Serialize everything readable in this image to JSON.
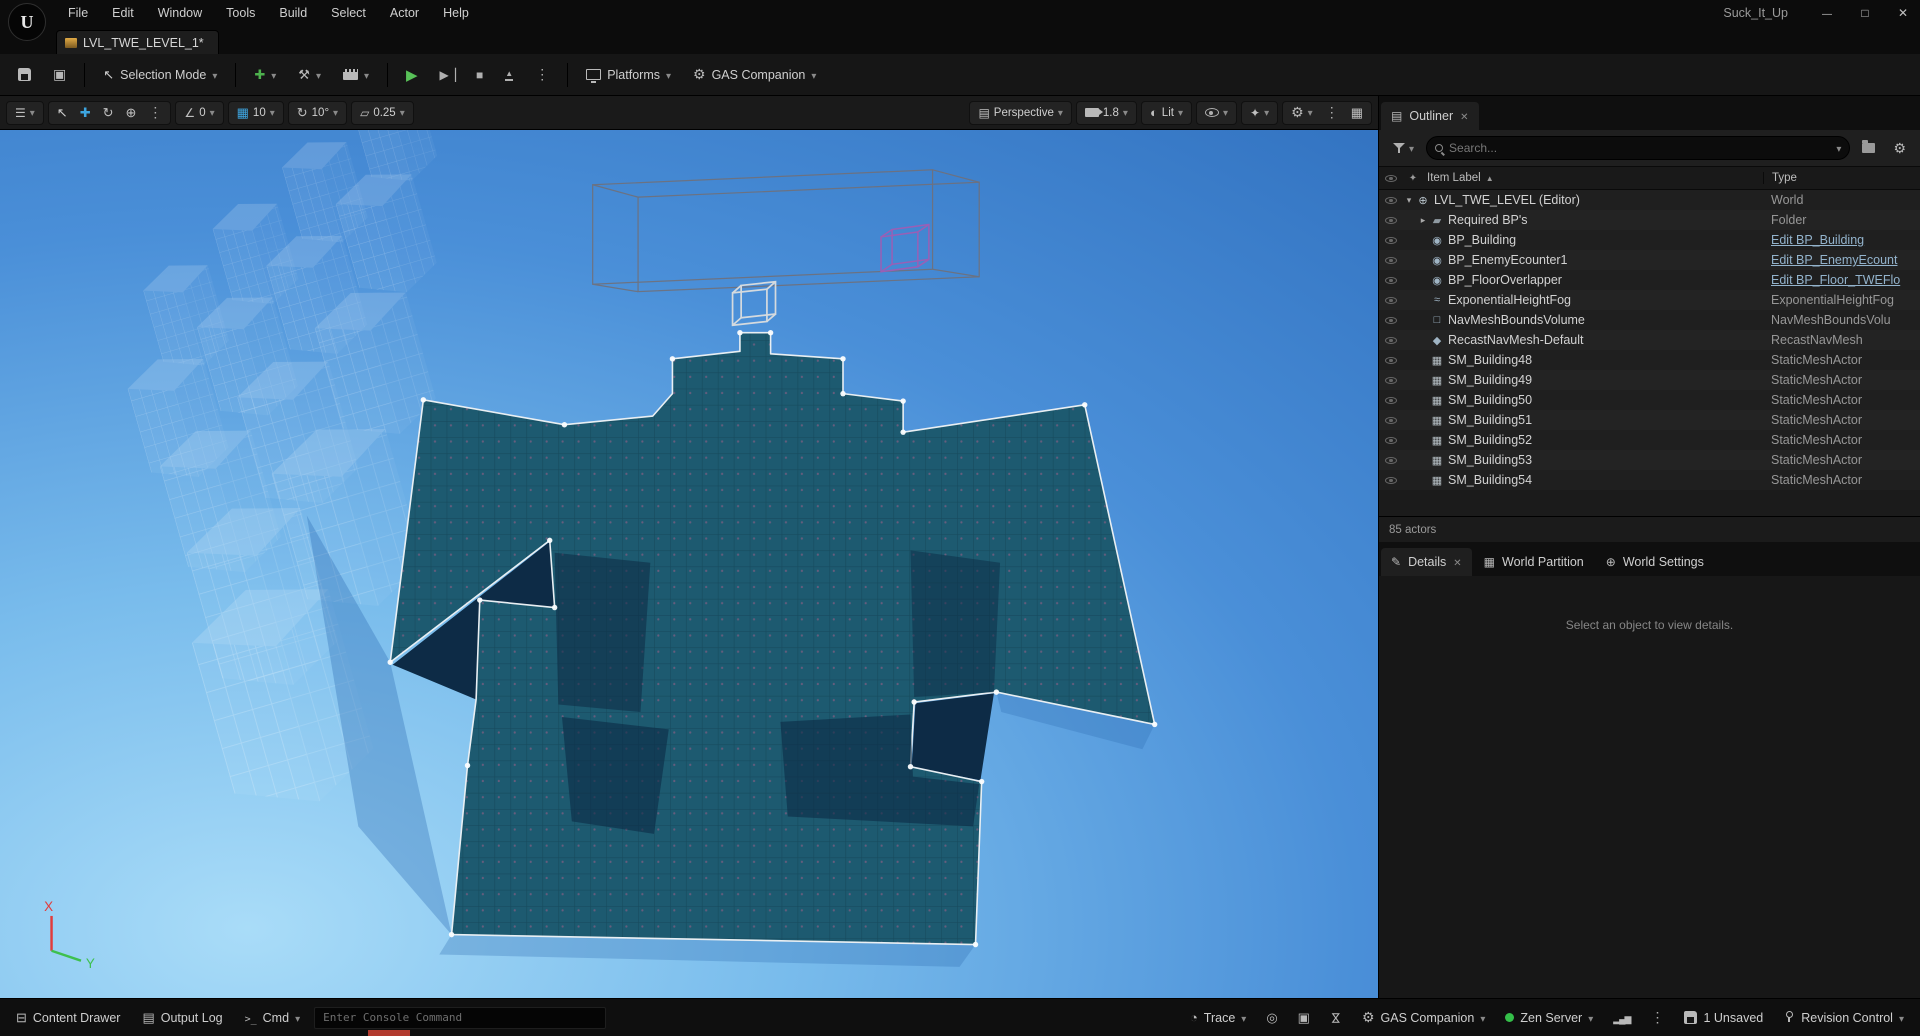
{
  "titlebar": {
    "menu": [
      "File",
      "Edit",
      "Window",
      "Tools",
      "Build",
      "Select",
      "Actor",
      "Help"
    ],
    "project": "Suck_It_Up"
  },
  "tab": {
    "label": "LVL_TWE_LEVEL_1*"
  },
  "toolbar": {
    "selection_mode": "Selection Mode",
    "platforms": "Platforms",
    "gas_companion": "GAS Companion"
  },
  "viewport": {
    "perspective": "Perspective",
    "camera_speed": "1.8",
    "view_mode": "Lit",
    "snap_actor": "0",
    "snap_grid": "10",
    "snap_rotation": "10°",
    "snap_scale": "0.25",
    "axis_x": "X",
    "axis_y": "Y"
  },
  "outliner": {
    "title": "Outliner",
    "search_placeholder": "Search...",
    "col_item": "Item Label",
    "col_type": "Type",
    "footer": "85 actors",
    "rows": [
      {
        "label": "LVL_TWE_LEVEL (Editor)",
        "type": "World",
        "icon": "world",
        "level": 0,
        "expanded": true
      },
      {
        "label": "Required BP's",
        "type": "Folder",
        "icon": "folder",
        "level": 1,
        "expanded": false
      },
      {
        "label": "BP_Building",
        "type": "Edit BP_Building",
        "icon": "blueprint",
        "level": 1,
        "link": true
      },
      {
        "label": "BP_EnemyEcounter1",
        "type": "Edit BP_EnemyEcount",
        "icon": "blueprint",
        "level": 1,
        "link": true
      },
      {
        "label": "BP_FloorOverlapper",
        "type": "Edit BP_Floor_TWEFlo",
        "icon": "blueprint",
        "level": 1,
        "link": true
      },
      {
        "label": "ExponentialHeightFog",
        "type": "ExponentialHeightFog",
        "icon": "fog",
        "level": 1
      },
      {
        "label": "NavMeshBoundsVolume",
        "type": "NavMeshBoundsVolu",
        "icon": "navmesh",
        "level": 1
      },
      {
        "label": "RecastNavMesh-Default",
        "type": "RecastNavMesh",
        "icon": "recast",
        "level": 1
      },
      {
        "label": "SM_Building48",
        "type": "StaticMeshActor",
        "icon": "staticmesh",
        "level": 1
      },
      {
        "label": "SM_Building49",
        "type": "StaticMeshActor",
        "icon": "staticmesh",
        "level": 1
      },
      {
        "label": "SM_Building50",
        "type": "StaticMeshActor",
        "icon": "staticmesh",
        "level": 1
      },
      {
        "label": "SM_Building51",
        "type": "StaticMeshActor",
        "icon": "staticmesh",
        "level": 1
      },
      {
        "label": "SM_Building52",
        "type": "StaticMeshActor",
        "icon": "staticmesh",
        "level": 1
      },
      {
        "label": "SM_Building53",
        "type": "StaticMeshActor",
        "icon": "staticmesh",
        "level": 1
      },
      {
        "label": "SM_Building54",
        "type": "StaticMeshActor",
        "icon": "staticmesh",
        "level": 1
      }
    ]
  },
  "details": {
    "tab_details": "Details",
    "tab_world_partition": "World Partition",
    "tab_world_settings": "World Settings",
    "empty": "Select an object to view details."
  },
  "statusbar": {
    "content_drawer": "Content Drawer",
    "output_log": "Output Log",
    "cmd": "Cmd",
    "console_placeholder": "Enter Console Command",
    "trace": "Trace",
    "gas_companion": "GAS Companion",
    "zen_server": "Zen Server",
    "unsaved": "1 Unsaved",
    "revision_control": "Revision Control"
  }
}
